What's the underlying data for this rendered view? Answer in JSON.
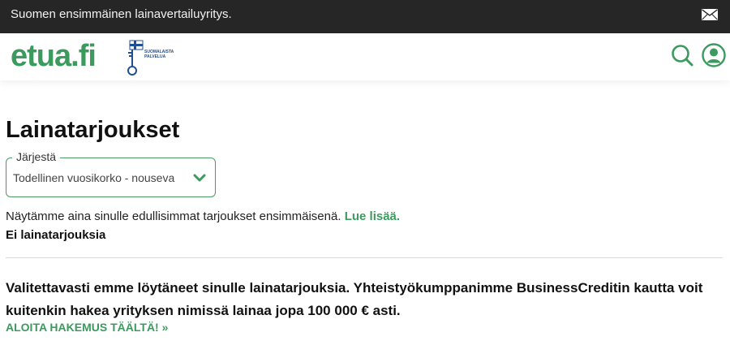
{
  "topbar": {
    "tagline": "Suomen ensimmäinen lainavertailuyritys."
  },
  "header": {
    "logo_text": "etua.fi",
    "badge_text": "SUOMALAISTA PALVELUA"
  },
  "page": {
    "title": "Lainatarjoukset",
    "sort": {
      "legend": "Järjestä",
      "selected": "Todellinen vuosikorko - nouseva"
    },
    "info_text": "Näytämme aina sinulle edullisimmat tarjoukset ensimmäisenä.",
    "info_link": "Lue lisää.",
    "no_offers": "Ei lainatarjouksia",
    "sorry_text": "Valitettavasti emme löytäneet sinulle lainatarjouksia. Yhteistyökumppanimme BusinessCreditin kautta voit kuitenkin hakea yrityksen nimissä lainaa jopa 100 000 € asti.",
    "cta_text": "ALOITA HAKEMUS TÄÄLTÄ! »"
  },
  "icons": {
    "mail": "mail-icon",
    "search": "search-icon",
    "user": "user-icon",
    "chevron": "chevron-down-icon",
    "badge": "key-flag-badge"
  },
  "colors": {
    "brand_green": "#3c9a5f",
    "topbar_bg": "#262626",
    "badge_blue": "#1f4f94"
  }
}
